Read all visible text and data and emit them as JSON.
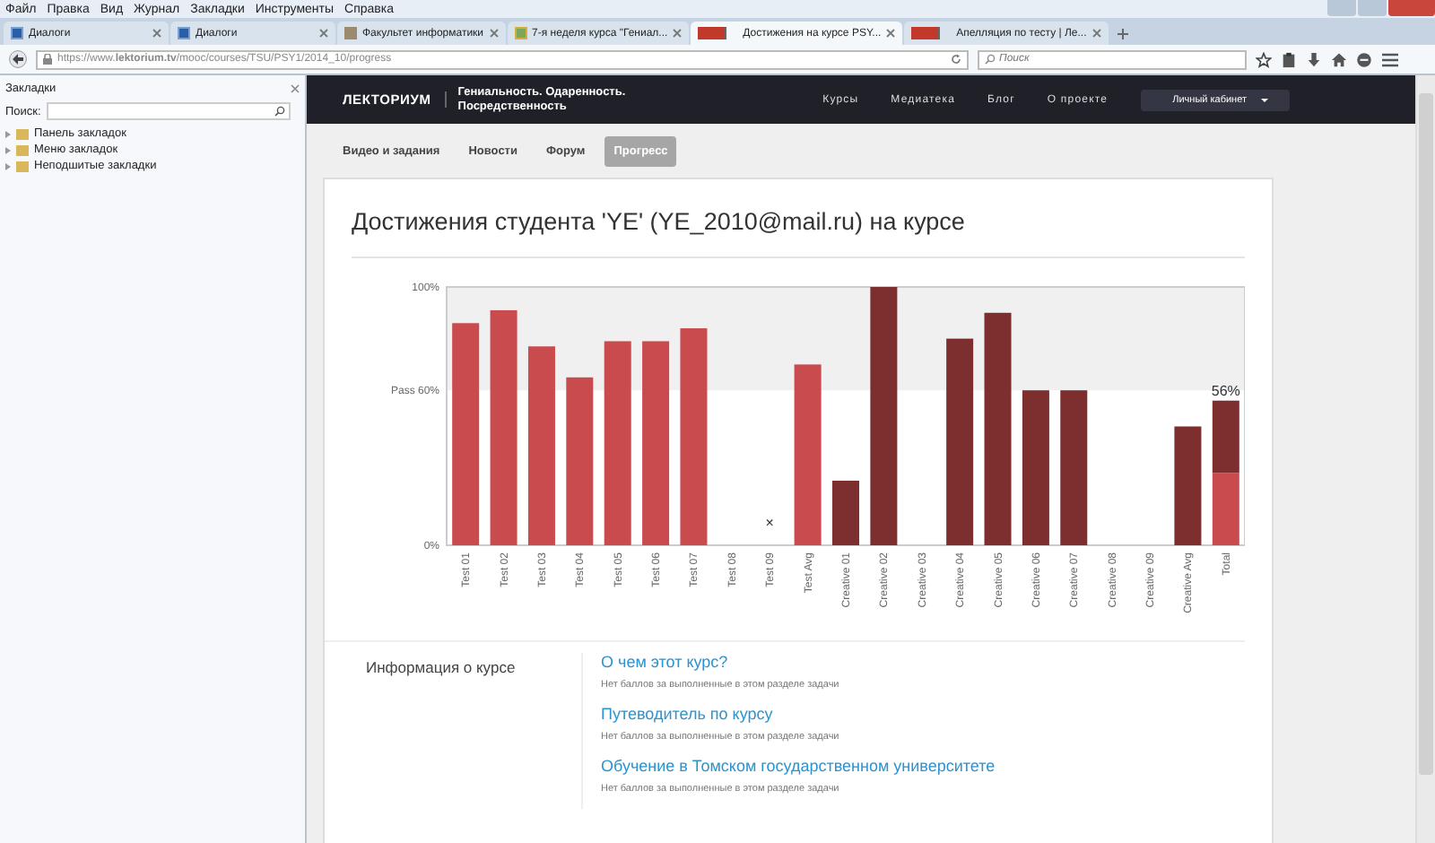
{
  "browser": {
    "menu": [
      "Файл",
      "Правка",
      "Вид",
      "Журнал",
      "Закладки",
      "Инструменты",
      "Справка"
    ],
    "tabs": [
      {
        "title": "Диалоги",
        "selected": false
      },
      {
        "title": "Диалоги",
        "selected": false
      },
      {
        "title": "Факультет информатики",
        "selected": false
      },
      {
        "title": "7-я неделя курса \"Гениал...",
        "selected": false
      },
      {
        "title": "Достижения на курсе PSY...",
        "selected": true
      },
      {
        "title": "Апелляция по тесту | Ле...",
        "selected": false
      }
    ],
    "url": "https://www.**lektorium.tv**/mooc/courses/TSU/PSY1/2014_10/progress",
    "search": {
      "placeholder": "Поиск"
    }
  },
  "sidebar": {
    "title": "Закладки",
    "search_label": "Поиск:",
    "items": [
      {
        "label": "Панель закладок",
        "expanded": false
      },
      {
        "label": "Меню закладок",
        "expanded": false
      },
      {
        "label": "Неподшитые закладки",
        "expanded": false
      }
    ]
  },
  "site": {
    "logo": "ЛЕКТОРИУМ",
    "tagline": "Гениальность. Одаренность. Посредственность",
    "nav": [
      "Курсы",
      "Медиатека",
      "Блог",
      "О проекте"
    ],
    "account_button": "Личный кабинет",
    "tabs": [
      {
        "label": "Видео и задания",
        "selected": false
      },
      {
        "label": "Новости",
        "selected": false
      },
      {
        "label": "Форум",
        "selected": false
      },
      {
        "label": "Прогресс",
        "selected": true
      }
    ]
  },
  "progress": {
    "title": "Достижения студента 'YE' (YE_2010@mail.ru) на курсе",
    "chart_data": {
      "type": "bar",
      "stacked": true,
      "categories": [
        "Test 01",
        "Test 02",
        "Test 03",
        "Test 04",
        "Test 05",
        "Test 06",
        "Test 07",
        "Test 08",
        "Test 09",
        "Test Avg",
        "Creative 01",
        "Creative 02",
        "Creative 03",
        "Creative 04",
        "Creative 05",
        "Creative 06",
        "Creative 07",
        "Creative 08",
        "Creative 09",
        "Creative Avg",
        "Total"
      ],
      "series": [
        {
          "color": "#c94b4e",
          "values": [
            86,
            91,
            77,
            65,
            79,
            79,
            84,
            null,
            0,
            70,
            null,
            null,
            null,
            null,
            null,
            null,
            null,
            null,
            null,
            null,
            28
          ]
        },
        {
          "color": "#7d2f30",
          "values": [
            null,
            null,
            null,
            null,
            null,
            null,
            null,
            null,
            null,
            null,
            25,
            100,
            null,
            80,
            90,
            60,
            60,
            null,
            null,
            46,
            28
          ]
        }
      ],
      "ylim": [
        0,
        100
      ],
      "yticks": [
        {
          "value": 0,
          "label": "0%"
        },
        {
          "value": 60,
          "label": "Pass 60%"
        },
        {
          "value": 100,
          "label": "100%"
        }
      ],
      "annotations": [
        {
          "x": "Test 09",
          "y": 0,
          "text": "×"
        },
        {
          "x": "Total",
          "y": 56,
          "text": "56%"
        }
      ]
    },
    "section": {
      "title": "Информация о курсе",
      "items": [
        {
          "title": "О чем этот курс?",
          "note": "Нет баллов за выполненные в этом разделе задачи"
        },
        {
          "title": "Путеводитель по курсу",
          "note": "Нет баллов за выполненные в этом разделе задачи"
        },
        {
          "title": "Обучение в Томском государственном университете",
          "note": "Нет баллов за выполненные в этом разделе задачи"
        }
      ]
    }
  }
}
